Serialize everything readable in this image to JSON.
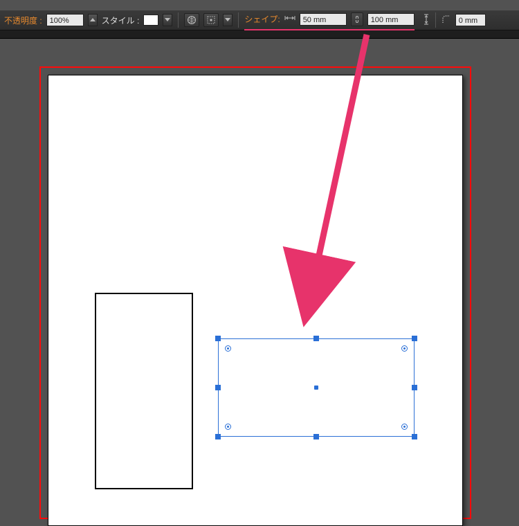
{
  "toolbar": {
    "opacity_label": "不透明度 :",
    "opacity_value": "100%",
    "style_label": "スタイル :",
    "shape_label": "シェイプ:",
    "width_value": "50 mm",
    "height_value": "100 mm",
    "corner_value": "0 mm"
  },
  "icons": {
    "globe": "globe-icon",
    "transform": "transform-icon",
    "width": "width-icon",
    "height": "height-icon",
    "link": "link-icon",
    "corner": "corner-radius-icon"
  },
  "colors": {
    "highlight": "#e88a2e",
    "underline": "#e7336b",
    "selection": "#2a6fd6",
    "frame": "#ff0a0a"
  }
}
